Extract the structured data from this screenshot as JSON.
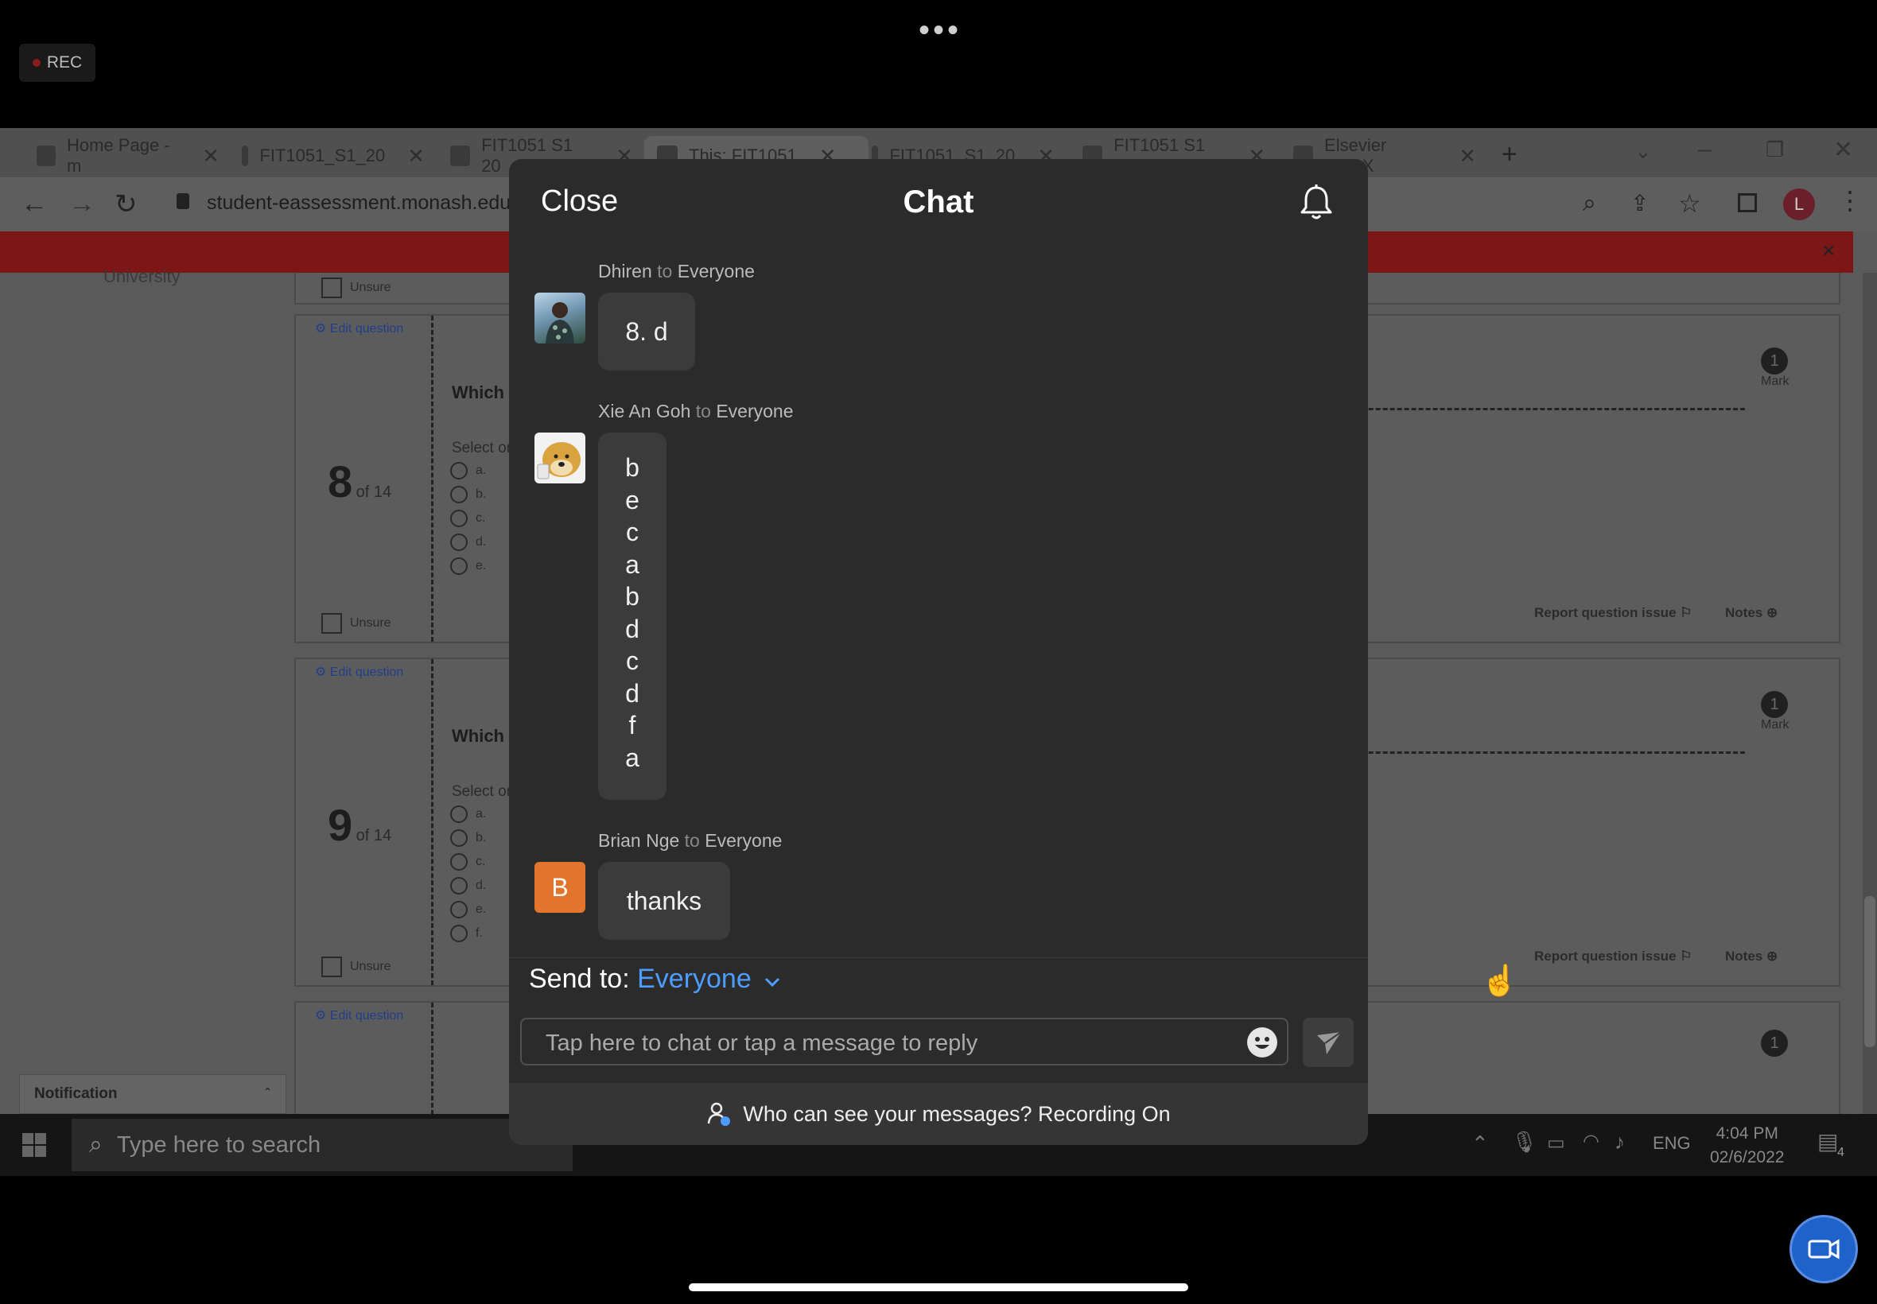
{
  "top": {
    "rec_label": "REC"
  },
  "browser": {
    "tabs": [
      {
        "label": "Home Page - m"
      },
      {
        "label": "FIT1051_S1_20"
      },
      {
        "label": "FIT1051 S1 20"
      },
      {
        "label": "This: FIT1051"
      },
      {
        "label": "FIT1051_S1_20"
      },
      {
        "label": "FIT1051 S1 20"
      },
      {
        "label": "Elsevier LaTeX"
      }
    ],
    "url": "student-eassessment.monash.edu",
    "avatar_letter": "L"
  },
  "exam": {
    "edit_question": "Edit question",
    "unsure": "Unsure",
    "q8": {
      "num": "8",
      "of": "of 14",
      "stem": "Which c",
      "select": "Select or",
      "options": [
        "a.",
        "b.",
        "c.",
        "d.",
        "e."
      ]
    },
    "q9": {
      "num": "9",
      "of": "of 14",
      "stem": "Which c",
      "select": "Select or",
      "options": [
        "a.",
        "b.",
        "c.",
        "d.",
        "e.",
        "f."
      ]
    },
    "mark_value": "1",
    "mark_label": "Mark",
    "report": "Report question issue",
    "notes": "Notes",
    "notification": "Notification",
    "university": "University"
  },
  "taskbar": {
    "search_placeholder": "Type here to search",
    "lang": "ENG",
    "time": "4:04 PM",
    "date": "02/6/2022",
    "notif_count": "4"
  },
  "chat": {
    "close_label": "Close",
    "title": "Chat",
    "messages": [
      {
        "sender": "Dhiren",
        "to_word": "to",
        "recipient": "Everyone",
        "text": "8. d"
      },
      {
        "sender": "Xie An Goh",
        "to_word": "to",
        "recipient": "Everyone",
        "lines": [
          "b",
          "e",
          "c",
          "a",
          "b",
          "d",
          "c",
          "d",
          "f",
          "a"
        ]
      },
      {
        "sender": "Brian Nge",
        "to_word": "to",
        "recipient": "Everyone",
        "avatar_letter": "B",
        "text": "thanks"
      }
    ],
    "send_to_label": "Send to:",
    "send_to_value": "Everyone",
    "input_placeholder": "Tap here to chat or tap a message to reply",
    "footer_text": "Who can see your messages? Recording On"
  },
  "colors": {
    "accent": "#4c9dff",
    "avatar_b": "#e3742b",
    "panel": "#2b2b2b"
  }
}
